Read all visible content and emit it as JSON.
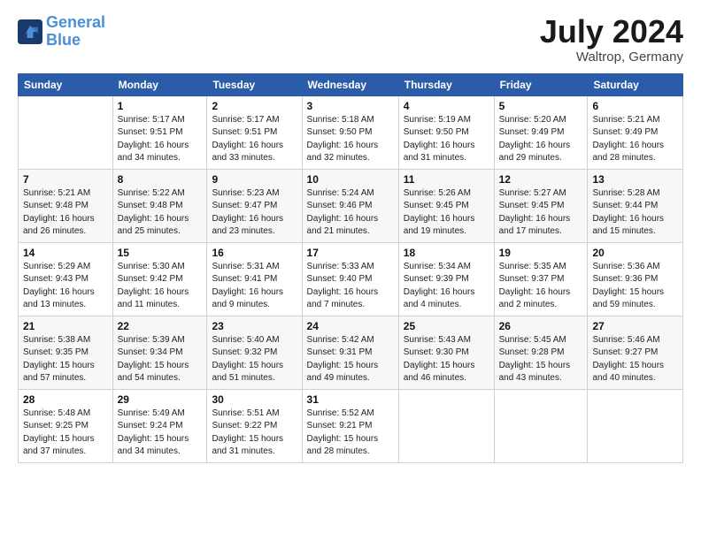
{
  "logo": {
    "line1": "General",
    "line2": "Blue"
  },
  "title": "July 2024",
  "location": "Waltrop, Germany",
  "days_header": [
    "Sunday",
    "Monday",
    "Tuesday",
    "Wednesday",
    "Thursday",
    "Friday",
    "Saturday"
  ],
  "weeks": [
    [
      {
        "day": "",
        "info": ""
      },
      {
        "day": "1",
        "info": "Sunrise: 5:17 AM\nSunset: 9:51 PM\nDaylight: 16 hours\nand 34 minutes."
      },
      {
        "day": "2",
        "info": "Sunrise: 5:17 AM\nSunset: 9:51 PM\nDaylight: 16 hours\nand 33 minutes."
      },
      {
        "day": "3",
        "info": "Sunrise: 5:18 AM\nSunset: 9:50 PM\nDaylight: 16 hours\nand 32 minutes."
      },
      {
        "day": "4",
        "info": "Sunrise: 5:19 AM\nSunset: 9:50 PM\nDaylight: 16 hours\nand 31 minutes."
      },
      {
        "day": "5",
        "info": "Sunrise: 5:20 AM\nSunset: 9:49 PM\nDaylight: 16 hours\nand 29 minutes."
      },
      {
        "day": "6",
        "info": "Sunrise: 5:21 AM\nSunset: 9:49 PM\nDaylight: 16 hours\nand 28 minutes."
      }
    ],
    [
      {
        "day": "7",
        "info": "Sunrise: 5:21 AM\nSunset: 9:48 PM\nDaylight: 16 hours\nand 26 minutes."
      },
      {
        "day": "8",
        "info": "Sunrise: 5:22 AM\nSunset: 9:48 PM\nDaylight: 16 hours\nand 25 minutes."
      },
      {
        "day": "9",
        "info": "Sunrise: 5:23 AM\nSunset: 9:47 PM\nDaylight: 16 hours\nand 23 minutes."
      },
      {
        "day": "10",
        "info": "Sunrise: 5:24 AM\nSunset: 9:46 PM\nDaylight: 16 hours\nand 21 minutes."
      },
      {
        "day": "11",
        "info": "Sunrise: 5:26 AM\nSunset: 9:45 PM\nDaylight: 16 hours\nand 19 minutes."
      },
      {
        "day": "12",
        "info": "Sunrise: 5:27 AM\nSunset: 9:45 PM\nDaylight: 16 hours\nand 17 minutes."
      },
      {
        "day": "13",
        "info": "Sunrise: 5:28 AM\nSunset: 9:44 PM\nDaylight: 16 hours\nand 15 minutes."
      }
    ],
    [
      {
        "day": "14",
        "info": "Sunrise: 5:29 AM\nSunset: 9:43 PM\nDaylight: 16 hours\nand 13 minutes."
      },
      {
        "day": "15",
        "info": "Sunrise: 5:30 AM\nSunset: 9:42 PM\nDaylight: 16 hours\nand 11 minutes."
      },
      {
        "day": "16",
        "info": "Sunrise: 5:31 AM\nSunset: 9:41 PM\nDaylight: 16 hours\nand 9 minutes."
      },
      {
        "day": "17",
        "info": "Sunrise: 5:33 AM\nSunset: 9:40 PM\nDaylight: 16 hours\nand 7 minutes."
      },
      {
        "day": "18",
        "info": "Sunrise: 5:34 AM\nSunset: 9:39 PM\nDaylight: 16 hours\nand 4 minutes."
      },
      {
        "day": "19",
        "info": "Sunrise: 5:35 AM\nSunset: 9:37 PM\nDaylight: 16 hours\nand 2 minutes."
      },
      {
        "day": "20",
        "info": "Sunrise: 5:36 AM\nSunset: 9:36 PM\nDaylight: 15 hours\nand 59 minutes."
      }
    ],
    [
      {
        "day": "21",
        "info": "Sunrise: 5:38 AM\nSunset: 9:35 PM\nDaylight: 15 hours\nand 57 minutes."
      },
      {
        "day": "22",
        "info": "Sunrise: 5:39 AM\nSunset: 9:34 PM\nDaylight: 15 hours\nand 54 minutes."
      },
      {
        "day": "23",
        "info": "Sunrise: 5:40 AM\nSunset: 9:32 PM\nDaylight: 15 hours\nand 51 minutes."
      },
      {
        "day": "24",
        "info": "Sunrise: 5:42 AM\nSunset: 9:31 PM\nDaylight: 15 hours\nand 49 minutes."
      },
      {
        "day": "25",
        "info": "Sunrise: 5:43 AM\nSunset: 9:30 PM\nDaylight: 15 hours\nand 46 minutes."
      },
      {
        "day": "26",
        "info": "Sunrise: 5:45 AM\nSunset: 9:28 PM\nDaylight: 15 hours\nand 43 minutes."
      },
      {
        "day": "27",
        "info": "Sunrise: 5:46 AM\nSunset: 9:27 PM\nDaylight: 15 hours\nand 40 minutes."
      }
    ],
    [
      {
        "day": "28",
        "info": "Sunrise: 5:48 AM\nSunset: 9:25 PM\nDaylight: 15 hours\nand 37 minutes."
      },
      {
        "day": "29",
        "info": "Sunrise: 5:49 AM\nSunset: 9:24 PM\nDaylight: 15 hours\nand 34 minutes."
      },
      {
        "day": "30",
        "info": "Sunrise: 5:51 AM\nSunset: 9:22 PM\nDaylight: 15 hours\nand 31 minutes."
      },
      {
        "day": "31",
        "info": "Sunrise: 5:52 AM\nSunset: 9:21 PM\nDaylight: 15 hours\nand 28 minutes."
      },
      {
        "day": "",
        "info": ""
      },
      {
        "day": "",
        "info": ""
      },
      {
        "day": "",
        "info": ""
      }
    ]
  ]
}
